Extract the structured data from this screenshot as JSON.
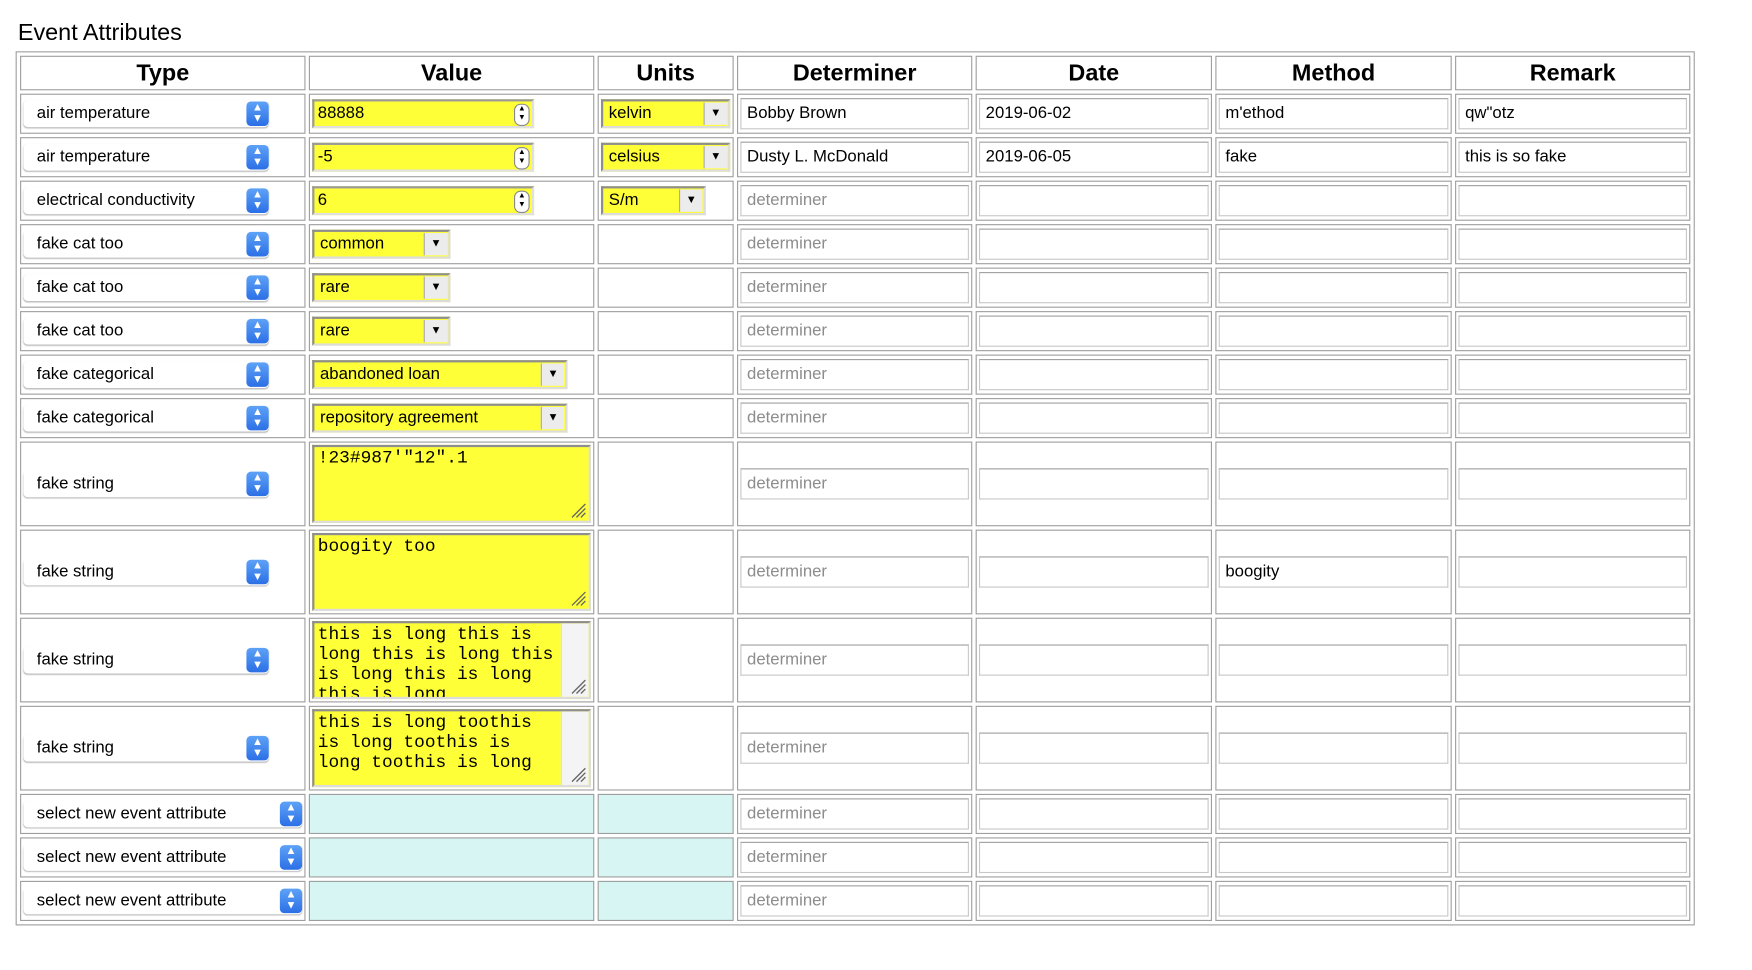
{
  "title": "Event Attributes",
  "headers": {
    "type": "Type",
    "value": "Value",
    "units": "Units",
    "determiner": "Determiner",
    "date": "Date",
    "method": "Method",
    "remark": "Remark"
  },
  "placeholders": {
    "determiner": "determiner"
  },
  "colors": {
    "required_fill": "#ffff38",
    "new_row_fill": "#d7f5f3",
    "select_arrow": "#2b6fe6"
  },
  "rows": [
    {
      "type": "air temperature",
      "value_kind": "number",
      "value": "88888",
      "units": "kelvin",
      "determiner": "Bobby Brown",
      "date": "2019-06-02",
      "method": "m'ethod",
      "remark": "qw\"otz"
    },
    {
      "type": "air temperature",
      "value_kind": "number",
      "value": "-5",
      "units": "celsius",
      "determiner": "Dusty L. McDonald",
      "date": "2019-06-05",
      "method": "fake",
      "remark": "this is so fake"
    },
    {
      "type": "electrical conductivity",
      "value_kind": "number",
      "value": "6",
      "units": "S/m",
      "determiner": "",
      "date": "",
      "method": "",
      "remark": ""
    },
    {
      "type": "fake cat too",
      "value_kind": "select",
      "value": "common",
      "units": "",
      "determiner": "",
      "date": "",
      "method": "",
      "remark": ""
    },
    {
      "type": "fake cat too",
      "value_kind": "select",
      "value": "rare",
      "units": "",
      "determiner": "",
      "date": "",
      "method": "",
      "remark": ""
    },
    {
      "type": "fake cat too",
      "value_kind": "select",
      "value": "rare",
      "units": "",
      "determiner": "",
      "date": "",
      "method": "",
      "remark": ""
    },
    {
      "type": "fake categorical",
      "value_kind": "select-wide",
      "value": "abandoned loan",
      "units": "",
      "determiner": "",
      "date": "",
      "method": "",
      "remark": ""
    },
    {
      "type": "fake categorical",
      "value_kind": "select-wide",
      "value": "repository agreement",
      "units": "",
      "determiner": "",
      "date": "",
      "method": "",
      "remark": ""
    },
    {
      "type": "fake string",
      "value_kind": "textarea",
      "value": "!23#987'\"12\".1",
      "units": "",
      "determiner": "",
      "date": "",
      "method": "",
      "remark": ""
    },
    {
      "type": "fake string",
      "value_kind": "textarea",
      "value": "boogity too",
      "units": "",
      "determiner": "",
      "date": "",
      "method": "boogity",
      "remark": ""
    },
    {
      "type": "fake string",
      "value_kind": "textarea-scroll",
      "value": "this is long this is long this is long this is long this is long this is long",
      "units": "",
      "determiner": "",
      "date": "",
      "method": "",
      "remark": ""
    },
    {
      "type": "fake string",
      "value_kind": "textarea-scroll",
      "value": "this is long toothis is long toothis is long toothis is long",
      "units": "",
      "determiner": "",
      "date": "",
      "method": "",
      "remark": ""
    },
    {
      "type": "select new event attribute",
      "value_kind": "new",
      "value": "",
      "units": "",
      "determiner": "",
      "date": "",
      "method": "",
      "remark": ""
    },
    {
      "type": "select new event attribute",
      "value_kind": "new",
      "value": "",
      "units": "",
      "determiner": "",
      "date": "",
      "method": "",
      "remark": ""
    },
    {
      "type": "select new event attribute",
      "value_kind": "new",
      "value": "",
      "units": "",
      "determiner": "",
      "date": "",
      "method": "",
      "remark": ""
    }
  ]
}
